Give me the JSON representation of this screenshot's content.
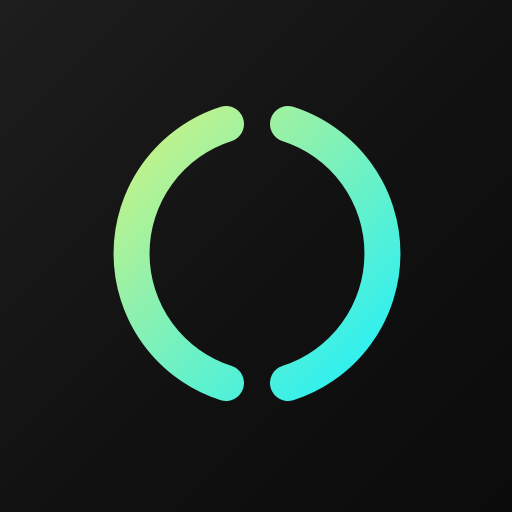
{
  "icon": {
    "name": "split-ring-logo",
    "colors": {
      "background": "#111111",
      "gradient_start": "#d9f27a",
      "gradient_end": "#19f0ff"
    }
  }
}
